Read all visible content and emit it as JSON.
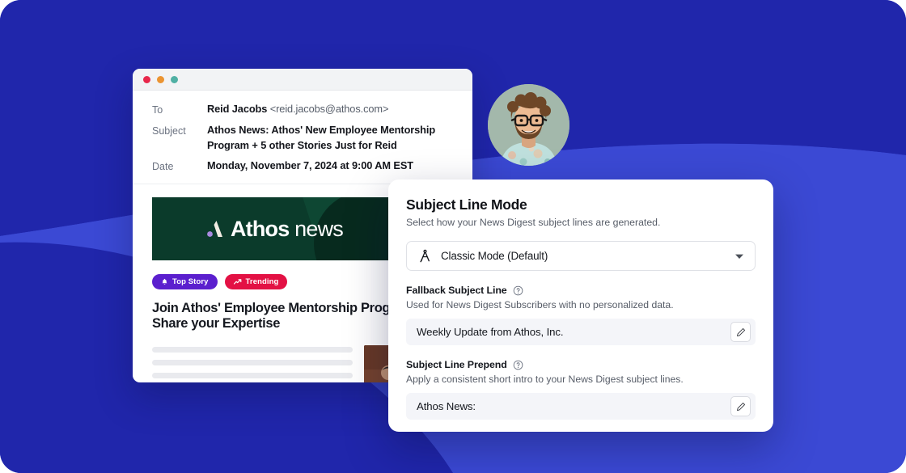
{
  "theme": {
    "bg_blue_light": "#3b49d4",
    "bg_blue_dark": "#2026ab",
    "panel_bg": "#ffffff",
    "banner_green": "#0b3b2b",
    "badge_top_story": "#5b1fce",
    "badge_trending": "#e31144",
    "input_bg": "#f4f5f9"
  },
  "email_window": {
    "traffic_lights": [
      "close-red",
      "minimize-amber",
      "maximize-teal"
    ],
    "fields": [
      {
        "label": "To",
        "name": "Reid Jacobs",
        "detail": "<reid.jacobs@athos.com>"
      },
      {
        "label": "Subject",
        "value": "Athos News: Athos' New Employee Mentorship Program + 5 other Stories Just for Reid"
      },
      {
        "label": "Date",
        "value": "Monday, November 7, 2024 at 9:00 AM EST"
      }
    ],
    "banner": {
      "logo_bold": "Athos",
      "logo_light": "news"
    },
    "badges": [
      {
        "label": "Top Story",
        "icon": "bell-icon",
        "color": "#5b1fce"
      },
      {
        "label": "Trending",
        "icon": "trend-up-icon",
        "color": "#e31144"
      }
    ],
    "headline": "Join Athos' Employee Mentorship Program + Share your Expertise",
    "skeleton_lines": 4
  },
  "avatar": {
    "name": "avatar",
    "description": "Portrait of a smiling man with curly brown hair, glasses and beard wearing a floral shirt"
  },
  "panel": {
    "title": "Subject Line Mode",
    "subtitle": "Select how your News Digest subject lines are generated.",
    "mode_select": {
      "value": "Classic Mode (Default)",
      "icon": "compass-icon",
      "caret": "chevron-down-icon"
    },
    "fields": [
      {
        "title": "Fallback Subject Line",
        "help_icon": "help-circle-icon",
        "description": "Used for News Digest Subscribers with no personalized data.",
        "value": "Weekly Update from Athos, Inc.",
        "edit_icon": "pencil-icon"
      },
      {
        "title": "Subject Line Prepend",
        "help_icon": "help-circle-icon",
        "description": "Apply a consistent short intro to your News Digest subject lines.",
        "value": "Athos News:",
        "edit_icon": "pencil-icon"
      }
    ]
  }
}
